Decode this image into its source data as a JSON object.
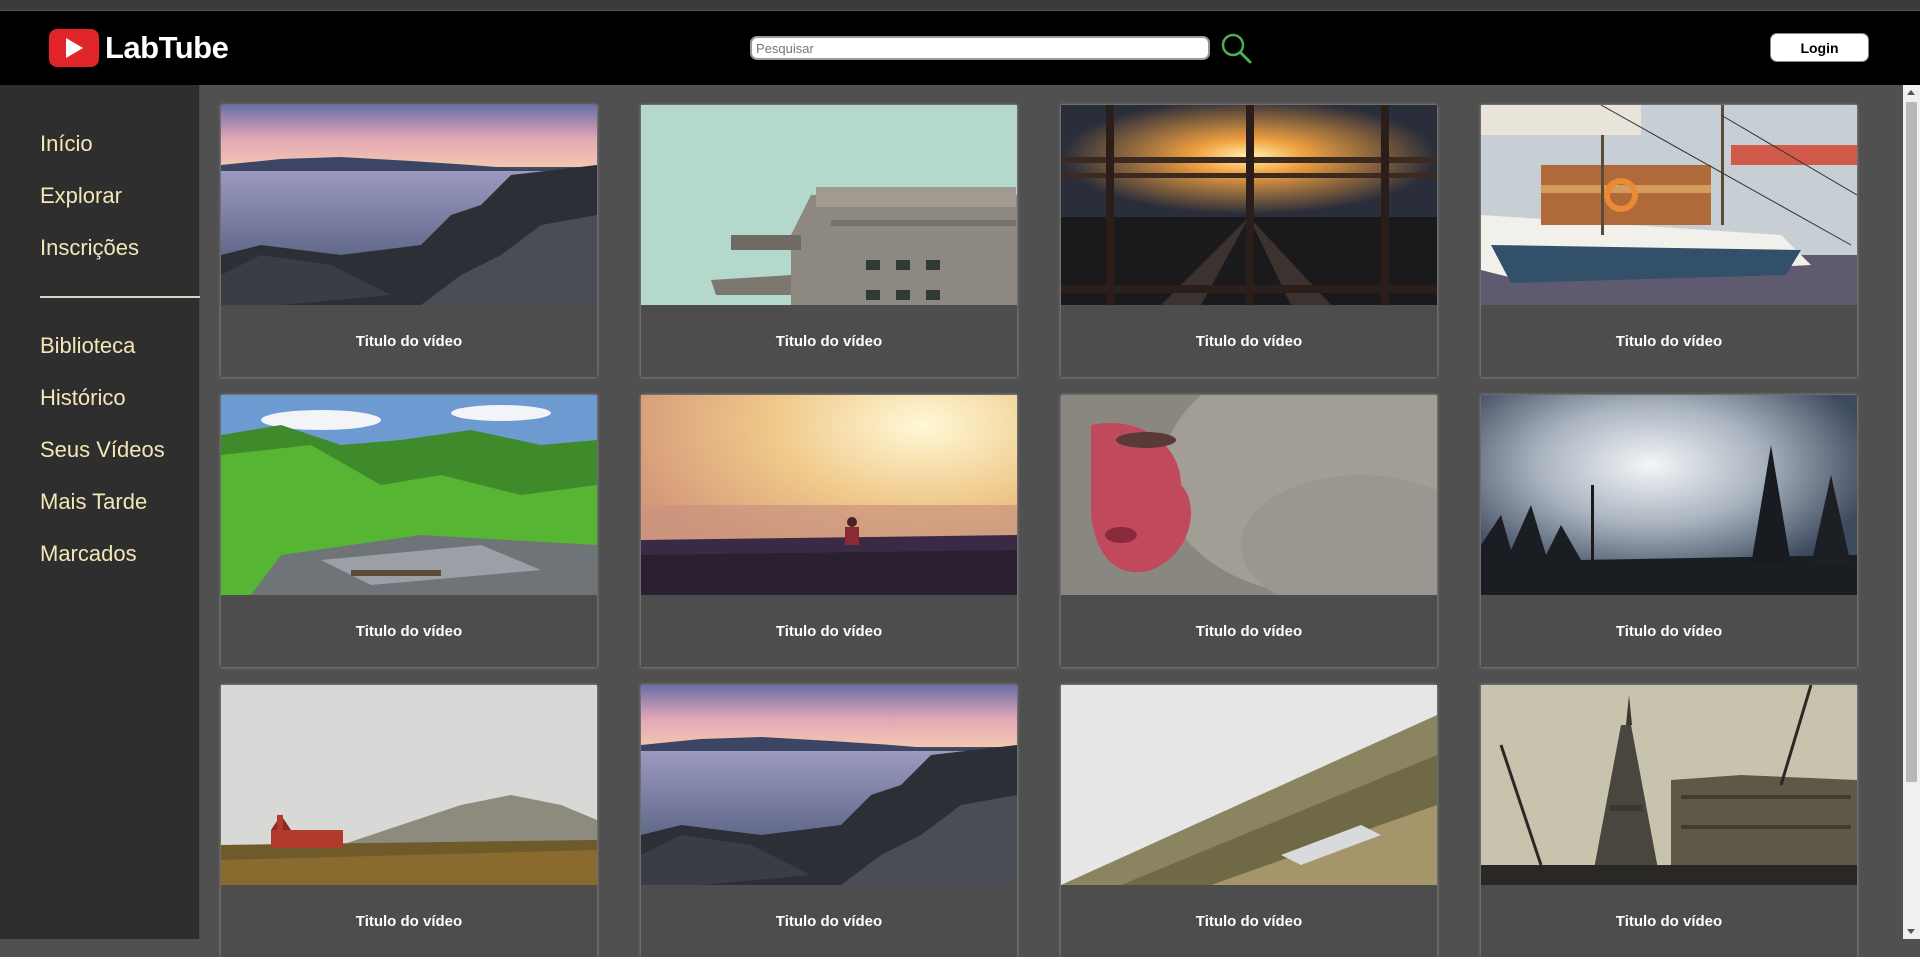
{
  "app": {
    "name": "LabTube"
  },
  "search": {
    "placeholder": "Pesquisar"
  },
  "header": {
    "login_label": "Login"
  },
  "sidebar": {
    "items": [
      {
        "label": "Início"
      },
      {
        "label": "Explorar"
      },
      {
        "label": "Inscrições"
      },
      {
        "label": "Biblioteca"
      },
      {
        "label": "Histórico"
      },
      {
        "label": "Seus Vídeos"
      },
      {
        "label": "Mais Tarde"
      },
      {
        "label": "Marcados"
      }
    ]
  },
  "videos": [
    {
      "title": "Titulo do vídeo",
      "thumbnail": "sea-rocks-sunset"
    },
    {
      "title": "Titulo do vídeo",
      "thumbnail": "concrete-bunker-building"
    },
    {
      "title": "Titulo do vídeo",
      "thumbnail": "highway-sunset-through-railing"
    },
    {
      "title": "Titulo do vídeo",
      "thumbnail": "sailboats-in-harbor"
    },
    {
      "title": "Titulo do vídeo",
      "thumbnail": "green-forest-river"
    },
    {
      "title": "Titulo do vídeo",
      "thumbnail": "person-in-field-sunset"
    },
    {
      "title": "Titulo do vídeo",
      "thumbnail": "red-faced-monkey"
    },
    {
      "title": "Titulo do vídeo",
      "thumbnail": "misty-forest-sky"
    },
    {
      "title": "Titulo do vídeo",
      "thumbnail": "red-house-mountain"
    },
    {
      "title": "Titulo do vídeo",
      "thumbnail": "sea-rocks-sunset"
    },
    {
      "title": "Titulo do vídeo",
      "thumbnail": "foggy-forest-hillside"
    },
    {
      "title": "Titulo do vídeo",
      "thumbnail": "eiffel-tower-paris"
    }
  ],
  "colors": {
    "header_bg": "#000000",
    "sidebar_bg": "#2f2e2f",
    "main_bg": "#505050",
    "nav_text": "#f2e7b6",
    "logo_red": "#e0242a",
    "search_icon": "#4caf50"
  }
}
